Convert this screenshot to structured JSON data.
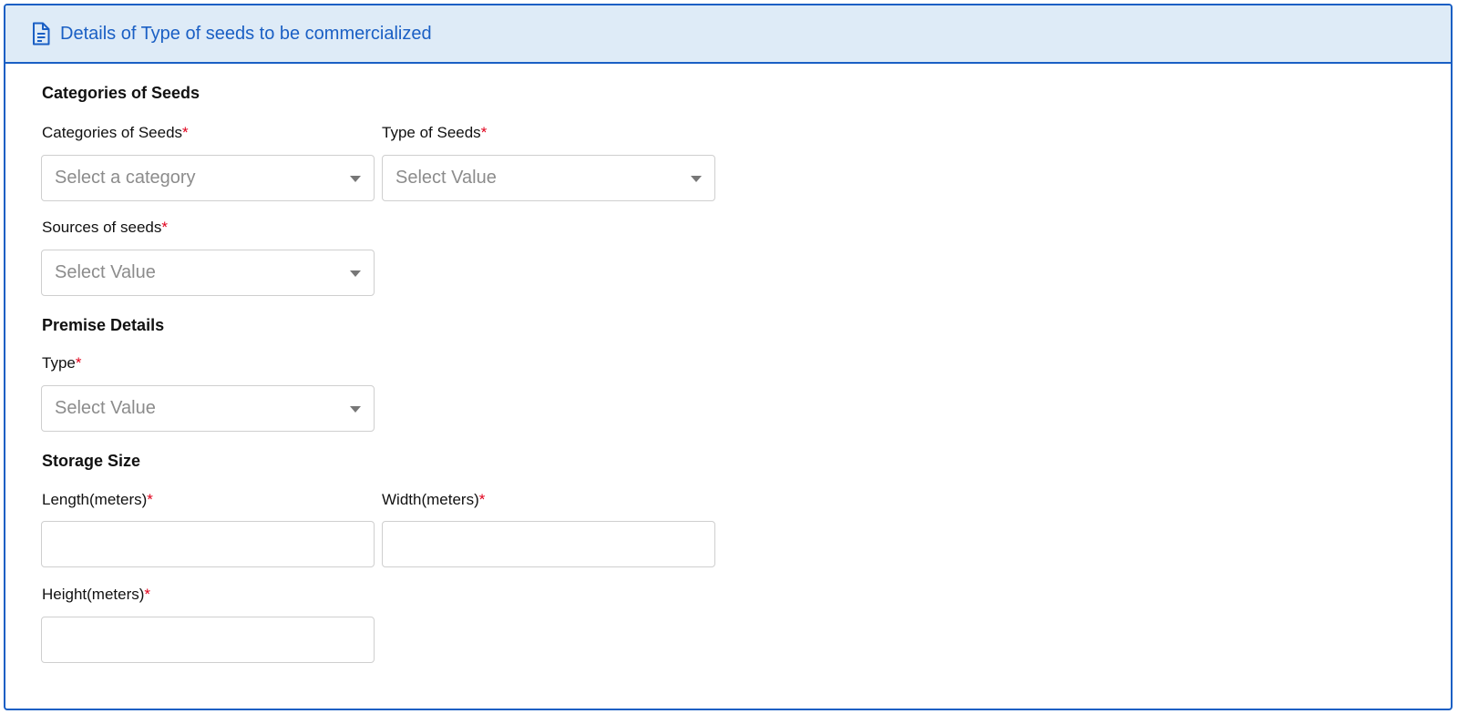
{
  "header": {
    "title": "Details of Type of seeds to be commercialized",
    "icon": "document-icon"
  },
  "sections": {
    "categories": {
      "title": "Categories of Seeds"
    },
    "premise": {
      "title": "Premise Details"
    },
    "storage": {
      "title": "Storage Size"
    }
  },
  "fields": {
    "category": {
      "label": "Categories of Seeds",
      "placeholder": "Select a category"
    },
    "seed_type": {
      "label": "Type of Seeds",
      "placeholder": "Select Value"
    },
    "sources": {
      "label": "Sources of seeds",
      "placeholder": "Select Value"
    },
    "premise_type": {
      "label": "Type",
      "placeholder": "Select Value"
    },
    "length": {
      "label": "Length(meters)",
      "value": ""
    },
    "width": {
      "label": "Width(meters)",
      "value": ""
    },
    "height": {
      "label": "Height(meters)",
      "value": ""
    }
  },
  "required_marker": "*",
  "colors": {
    "accent": "#1a5fc4",
    "header_bg": "#deebf7",
    "required": "#e0001b"
  }
}
